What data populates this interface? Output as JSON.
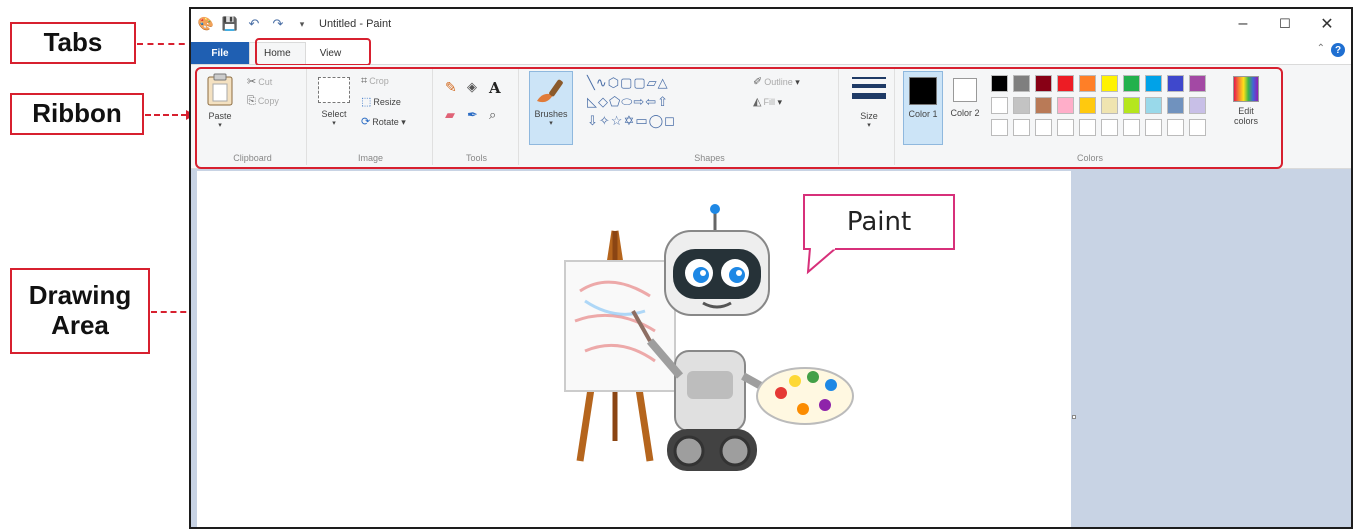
{
  "window": {
    "title": "Untitled - Paint",
    "minimize": "–",
    "maximize": "☐",
    "close": "✕"
  },
  "menubar": {
    "file": "File",
    "tabs": [
      "Home",
      "View"
    ],
    "help": "?"
  },
  "ribbon": {
    "clipboard": {
      "paste": "Paste",
      "cut": "Cut",
      "copy": "Copy",
      "label": "Clipboard"
    },
    "image": {
      "select": "Select",
      "crop": "Crop",
      "resize": "Resize",
      "rotate": "Rotate",
      "label": "Image"
    },
    "tools": {
      "label": "Tools",
      "text_tool": "A"
    },
    "brushes": {
      "label": "Brushes"
    },
    "shapes": {
      "outline": "Outline",
      "fill": "Fill",
      "label": "Shapes"
    },
    "size": {
      "label": "Size"
    },
    "colors": {
      "color1": "Color 1",
      "color2": "Color 2",
      "edit": "Edit colors",
      "label": "Colors",
      "row1": [
        "#000000",
        "#7f7f7f",
        "#880015",
        "#ed1c24",
        "#ff7f27",
        "#fff200",
        "#22b14c",
        "#00a2e8",
        "#3f48cc",
        "#a349a4"
      ],
      "row2": [
        "#ffffff",
        "#c3c3c3",
        "#b97a57",
        "#ffaec9",
        "#ffc90e",
        "#efe4b0",
        "#b5e61d",
        "#99d9ea",
        "#7092be",
        "#c8bfe7"
      ]
    }
  },
  "callouts": {
    "tabs": "Tabs",
    "ribbon": "Ribbon",
    "drawing_area_line1": "Drawing",
    "drawing_area_line2": "Area"
  },
  "bubble": {
    "text": "Paint"
  },
  "icons": {
    "paint_app": "paint-app-icon",
    "save": "save-icon",
    "undo": "undo-icon",
    "redo": "redo-icon"
  },
  "colors": {
    "accent": "#1f5fb2",
    "callout_red": "#d7202f",
    "bubble_border": "#d7307a",
    "workspace": "#c8d3e4"
  }
}
